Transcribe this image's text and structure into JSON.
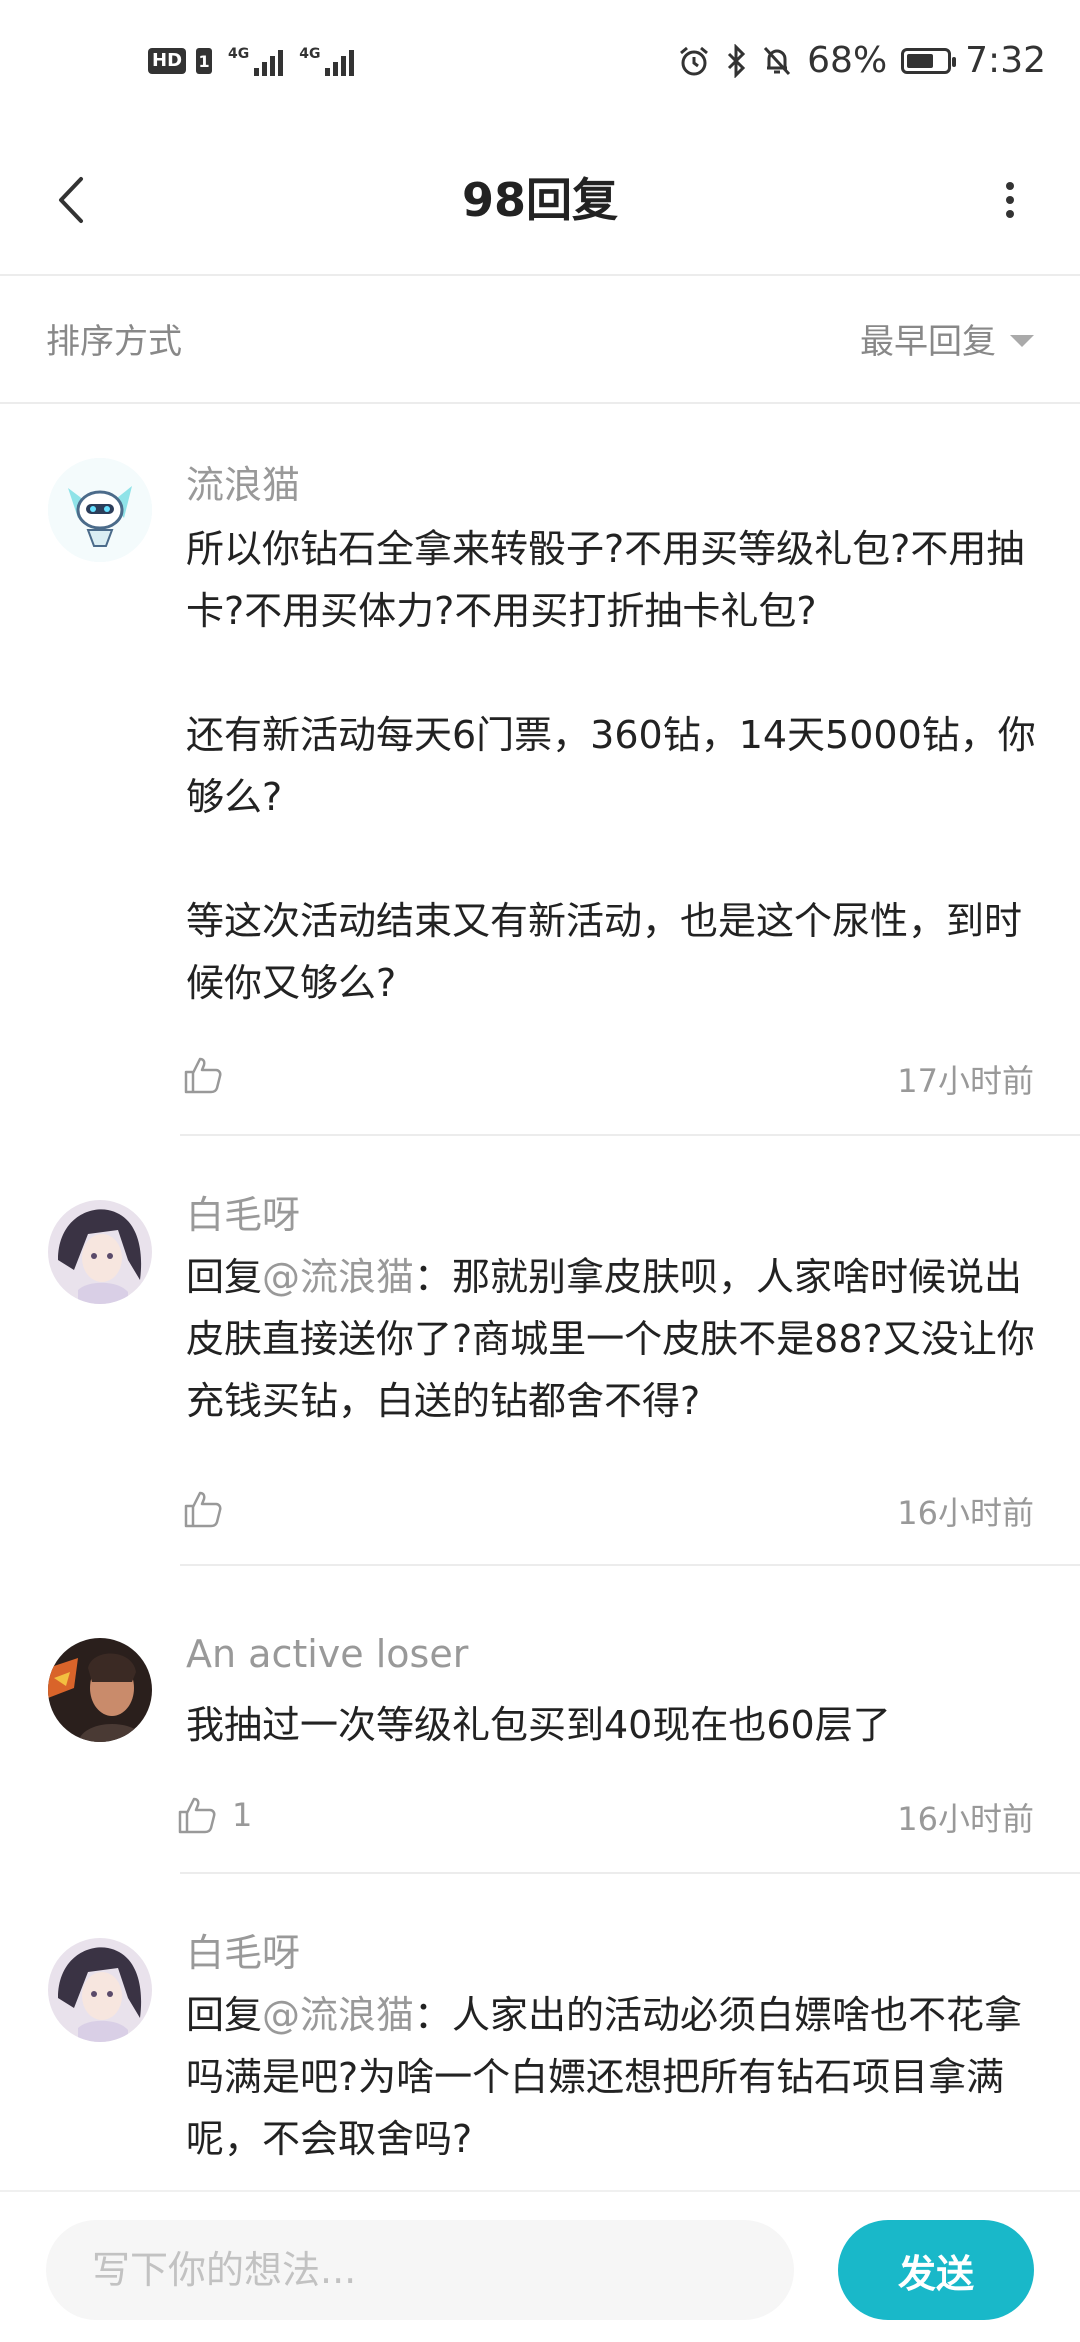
{
  "status_bar": {
    "hd": "HD",
    "sim": "1",
    "net1": "4G",
    "net2": "4G",
    "battery_pct": "68%",
    "battery_level": 0.68,
    "time": "7:32"
  },
  "header": {
    "title": "98回复"
  },
  "sort": {
    "label": "排序方式",
    "value": "最早回复"
  },
  "comments": [
    {
      "name": "流浪猫",
      "text": "所以你钻石全拿来转骰子?不用买等级礼包?不用抽卡?不用买体力?不用买打折抽卡礼包?\n\n还有新活动每天6门票，360钻，14天5000钻，你够么?\n\n等这次活动结束又有新活动，也是这个尿性，到时候你又够么?",
      "likes": "",
      "time": "17小时前"
    },
    {
      "name": "白毛呀",
      "reply_prefix": "回复",
      "mention": "@流浪猫",
      "text": "：那就别拿皮肤呗，人家啥时候说出皮肤直接送你了?商城里一个皮肤不是88?又没让你充钱买钻，白送的钻都舍不得?",
      "likes": "",
      "time": "16小时前"
    },
    {
      "name": "An active loser",
      "text": "我抽过一次等级礼包买到40现在也60层了",
      "likes": "1",
      "time": "16小时前"
    },
    {
      "name": "白毛呀",
      "reply_prefix": "回复",
      "mention": "@流浪猫",
      "text": "：人家出的活动必须白嫖啥也不花拿吗满是吧?为啥一个白嫖还想把所有钻石项目拿满呢，不会取舍吗?",
      "likes": "",
      "time": ""
    }
  ],
  "composer": {
    "placeholder": "写下你的想法...",
    "send_label": "发送"
  },
  "colors": {
    "accent": "#19b8c9",
    "muted": "#999999"
  }
}
